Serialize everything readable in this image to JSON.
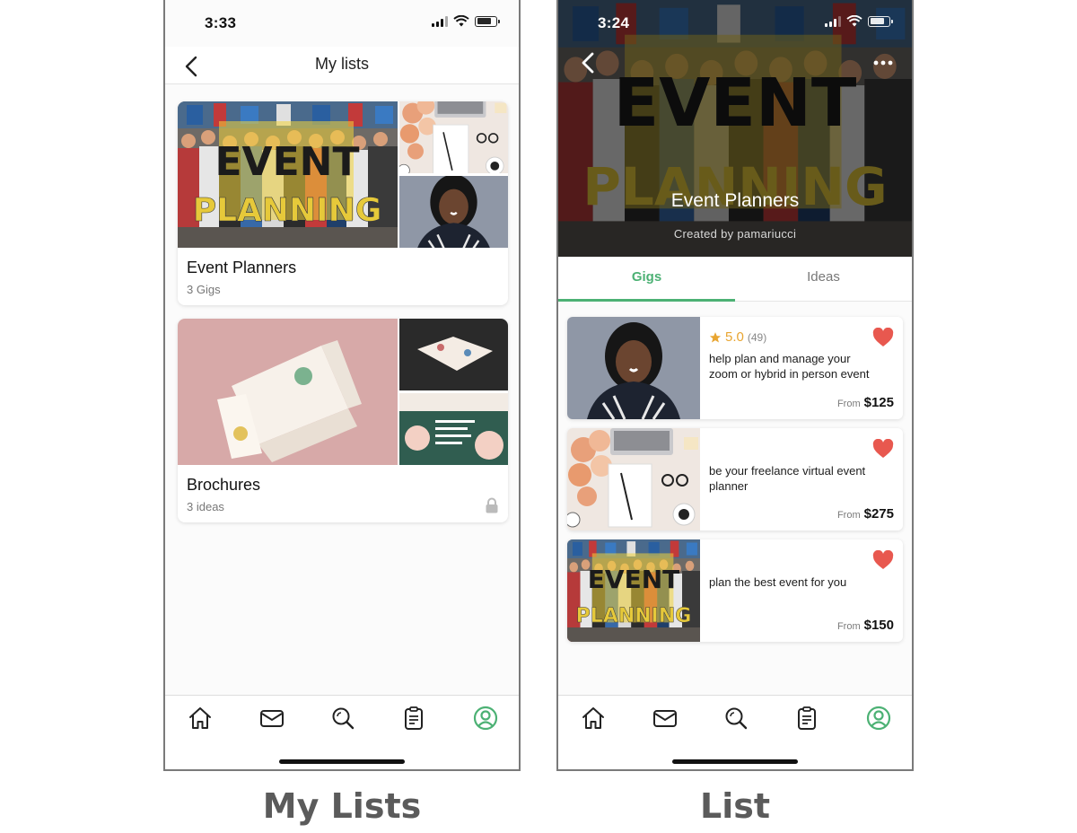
{
  "captions": {
    "left": "My Lists",
    "right": "List"
  },
  "colors": {
    "accent_green": "#4cb174",
    "heart_red": "#e8584f",
    "star_gold": "#e8a531"
  },
  "my_lists_screen": {
    "status_time": "3:33",
    "title": "My lists",
    "back_icon": "chevron-left-icon",
    "lists": [
      {
        "title": "Event Planners",
        "count": "3 Gigs",
        "locked": false,
        "banner_word1": "EVENT",
        "banner_word2": "PLANNING"
      },
      {
        "title": "Brochures",
        "count": "3 ideas",
        "locked": true
      }
    ]
  },
  "list_screen": {
    "status_time": "3:24",
    "title": "Event Planners",
    "created_by": "Created by pamariucci",
    "banner_word1": "EVENT",
    "banner_word2": "PLANNING",
    "tabs": [
      {
        "label": "Gigs",
        "active": true
      },
      {
        "label": "Ideas",
        "active": false
      }
    ],
    "gigs": [
      {
        "rating": "5.0",
        "reviews": "(49)",
        "description": "help plan and manage your zoom or hybrid in person event",
        "from_label": "From",
        "price": "$125",
        "favorited": true
      },
      {
        "rating": null,
        "reviews": null,
        "description": "be your freelance virtual event planner",
        "from_label": "From",
        "price": "$275",
        "favorited": true
      },
      {
        "rating": null,
        "reviews": null,
        "description": "plan the best event for you",
        "from_label": "From",
        "price": "$150",
        "favorited": true
      }
    ]
  },
  "tabbar": {
    "items": [
      {
        "name": "home",
        "icon": "home-icon",
        "active": false
      },
      {
        "name": "messages",
        "icon": "mail-icon",
        "active": false
      },
      {
        "name": "search",
        "icon": "search-icon",
        "active": false
      },
      {
        "name": "orders",
        "icon": "clipboard-icon",
        "active": false
      },
      {
        "name": "profile",
        "icon": "profile-icon",
        "active": true
      }
    ]
  }
}
